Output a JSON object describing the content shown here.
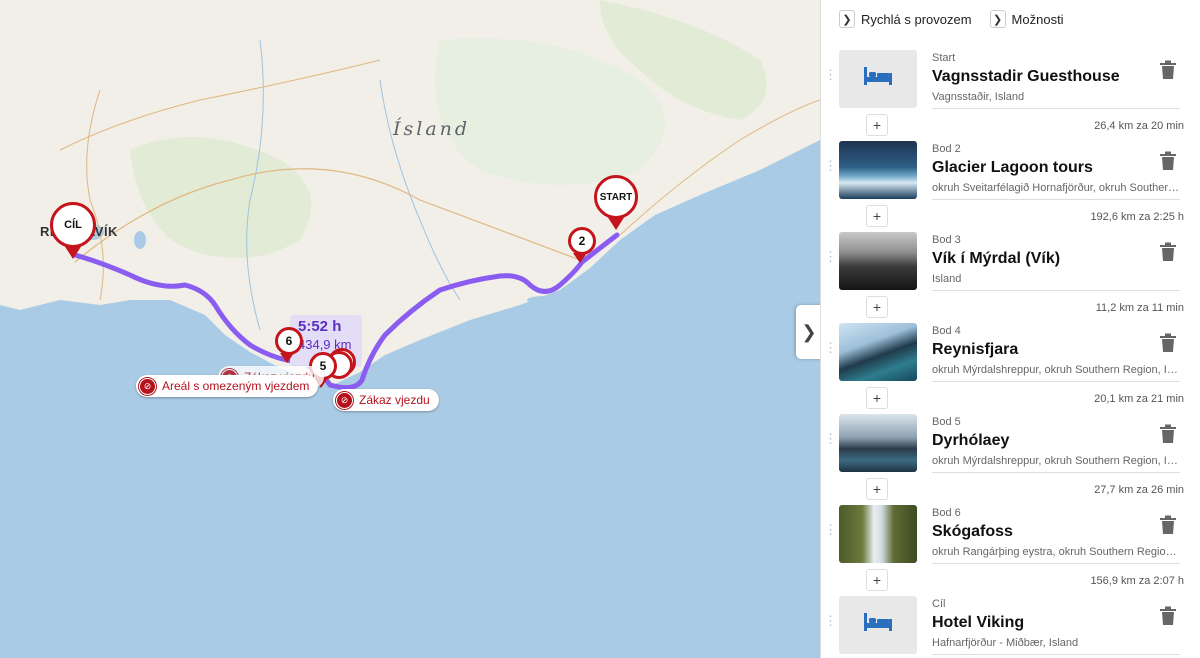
{
  "map": {
    "country_label": "Ísland",
    "city_label": "REYKJAVÍK",
    "route_info": {
      "time": "5:52 h",
      "distance": "434,9 km"
    },
    "markers": [
      {
        "label": "CÍL",
        "kind": "destination"
      },
      {
        "label": "START",
        "kind": "start"
      },
      {
        "label": "2",
        "kind": "waypoint"
      },
      {
        "label": "5",
        "kind": "waypoint"
      },
      {
        "label": "6",
        "kind": "waypoint"
      }
    ],
    "zones": [
      {
        "label": "Zákaz vjezdu",
        "icon": "no-vehicle-icon"
      },
      {
        "label": "Areál s omezeným vjezdem",
        "icon": "no-vehicle-icon"
      },
      {
        "label": "Zákaz vjezdu",
        "icon": "no-vehicle-icon"
      }
    ],
    "colors": {
      "route": "#8a5cf0",
      "marker": "#c4141c",
      "water": "#a9cbe5",
      "land": "#f1efe8"
    }
  },
  "toolbar": {
    "route_type": "Rychlá s provozem",
    "options": "Možnosti"
  },
  "stops": [
    {
      "kind": "Start",
      "name": "Vagnsstadir Guesthouse",
      "address": "Vagnsstaðir, Island",
      "image": "bed-icon"
    },
    {
      "kind": "Bod 2",
      "name": "Glacier Lagoon tours",
      "address": "okruh Sveitarfélagið Hornafjörður, okruh Southern Region, Island",
      "image": "glacier-photo"
    },
    {
      "kind": "Bod 3",
      "name": "Vík í Mýrdal (Vík)",
      "address": "Island",
      "image": "beach-photo"
    },
    {
      "kind": "Bod 4",
      "name": "Reynisfjara",
      "address": "okruh Mýrdalshreppur, okruh Southern Region, Island",
      "image": "cliff-photo"
    },
    {
      "kind": "Bod 5",
      "name": "Dyrhólaey",
      "address": "okruh Mýrdalshreppur, okruh Southern Region, Island",
      "image": "arch-photo"
    },
    {
      "kind": "Bod 6",
      "name": "Skógafoss",
      "address": "okruh Rangárþing eystra, okruh Southern Region, Island",
      "image": "waterfall-photo"
    },
    {
      "kind": "Cíl",
      "name": "Hotel Viking",
      "address": "Hafnarfjörður - Miðbær, Island",
      "image": "bed-icon"
    }
  ],
  "segments": [
    "26,4 km za 20 min",
    "192,6 km za 2:25 h",
    "11,2 km za 11 min",
    "20,1 km za 21 min",
    "27,7 km za 26 min",
    "156,9 km za 2:07 h"
  ]
}
